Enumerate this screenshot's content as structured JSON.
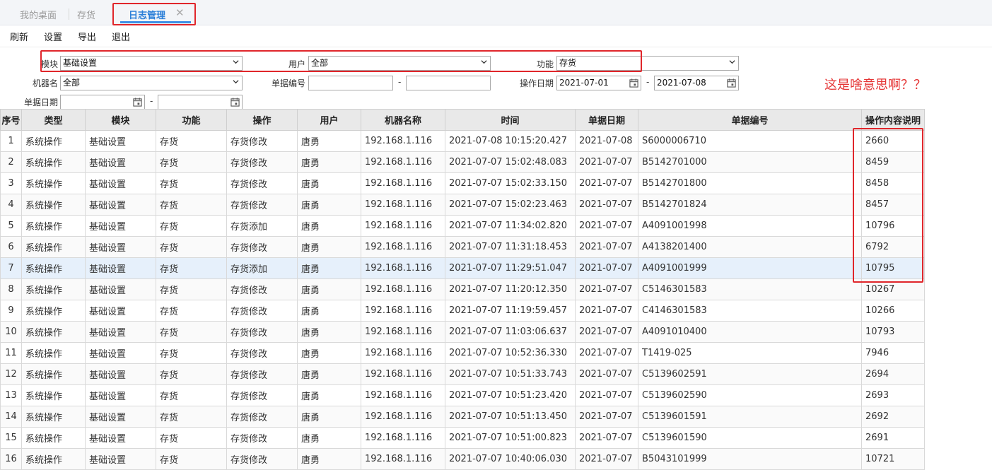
{
  "tabs": [
    {
      "label": "我的桌面",
      "active": false
    },
    {
      "label": "存货",
      "active": false
    },
    {
      "label": "日志管理",
      "active": true
    }
  ],
  "toolbar": {
    "refresh": "刷新",
    "settings": "设置",
    "export": "导出",
    "exit": "退出"
  },
  "filters": {
    "module_label": "模块",
    "module_value": "基础设置",
    "user_label": "用户",
    "user_value": "全部",
    "function_label": "功能",
    "function_value": "存货",
    "machine_label": "机器名",
    "machine_value": "全部",
    "docno_label": "单据编号",
    "docno_from": "",
    "docno_to": "",
    "opdate_label": "操作日期",
    "opdate_from": "2021-07-01",
    "opdate_to": "2021-07-08",
    "docdate_label": "单据日期",
    "docdate_from": "",
    "docdate_to": "",
    "dash": "-"
  },
  "annotation": "这是啥意思啊？？",
  "table": {
    "headers": [
      "序号",
      "类型",
      "模块",
      "功能",
      "操作",
      "用户",
      "机器名称",
      "时间",
      "单据日期",
      "单据编号",
      "操作内容说明"
    ],
    "rows": [
      [
        "1",
        "系统操作",
        "基础设置",
        "存货",
        "存货修改",
        "唐勇",
        "192.168.1.116",
        "2021-07-08 10:15:20.427",
        "2021-07-08",
        "S6000006710",
        "2660"
      ],
      [
        "2",
        "系统操作",
        "基础设置",
        "存货",
        "存货修改",
        "唐勇",
        "192.168.1.116",
        "2021-07-07 15:02:48.083",
        "2021-07-07",
        "B5142701000",
        "8459"
      ],
      [
        "3",
        "系统操作",
        "基础设置",
        "存货",
        "存货修改",
        "唐勇",
        "192.168.1.116",
        "2021-07-07 15:02:33.150",
        "2021-07-07",
        "B5142701800",
        "8458"
      ],
      [
        "4",
        "系统操作",
        "基础设置",
        "存货",
        "存货修改",
        "唐勇",
        "192.168.1.116",
        "2021-07-07 15:02:23.463",
        "2021-07-07",
        "B5142701824",
        "8457"
      ],
      [
        "5",
        "系统操作",
        "基础设置",
        "存货",
        "存货添加",
        "唐勇",
        "192.168.1.116",
        "2021-07-07 11:34:02.820",
        "2021-07-07",
        "A4091001998",
        "10796"
      ],
      [
        "6",
        "系统操作",
        "基础设置",
        "存货",
        "存货修改",
        "唐勇",
        "192.168.1.116",
        "2021-07-07 11:31:18.453",
        "2021-07-07",
        "A4138201400",
        "6792"
      ],
      [
        "7",
        "系统操作",
        "基础设置",
        "存货",
        "存货添加",
        "唐勇",
        "192.168.1.116",
        "2021-07-07 11:29:51.047",
        "2021-07-07",
        "A4091001999",
        "10795"
      ],
      [
        "8",
        "系统操作",
        "基础设置",
        "存货",
        "存货修改",
        "唐勇",
        "192.168.1.116",
        "2021-07-07 11:20:12.350",
        "2021-07-07",
        "C5146301583",
        "10267"
      ],
      [
        "9",
        "系统操作",
        "基础设置",
        "存货",
        "存货修改",
        "唐勇",
        "192.168.1.116",
        "2021-07-07 11:19:59.457",
        "2021-07-07",
        "C4146301583",
        "10266"
      ],
      [
        "10",
        "系统操作",
        "基础设置",
        "存货",
        "存货修改",
        "唐勇",
        "192.168.1.116",
        "2021-07-07 11:03:06.637",
        "2021-07-07",
        "A4091010400",
        "10793"
      ],
      [
        "11",
        "系统操作",
        "基础设置",
        "存货",
        "存货修改",
        "唐勇",
        "192.168.1.116",
        "2021-07-07 10:52:36.330",
        "2021-07-07",
        "T1419-025",
        "7946"
      ],
      [
        "12",
        "系统操作",
        "基础设置",
        "存货",
        "存货修改",
        "唐勇",
        "192.168.1.116",
        "2021-07-07 10:51:33.743",
        "2021-07-07",
        "C5139602591",
        "2694"
      ],
      [
        "13",
        "系统操作",
        "基础设置",
        "存货",
        "存货修改",
        "唐勇",
        "192.168.1.116",
        "2021-07-07 10:51:23.420",
        "2021-07-07",
        "C5139602590",
        "2693"
      ],
      [
        "14",
        "系统操作",
        "基础设置",
        "存货",
        "存货修改",
        "唐勇",
        "192.168.1.116",
        "2021-07-07 10:51:13.450",
        "2021-07-07",
        "C5139601591",
        "2692"
      ],
      [
        "15",
        "系统操作",
        "基础设置",
        "存货",
        "存货修改",
        "唐勇",
        "192.168.1.116",
        "2021-07-07 10:51:00.823",
        "2021-07-07",
        "C5139601590",
        "2691"
      ],
      [
        "16",
        "系统操作",
        "基础设置",
        "存货",
        "存货修改",
        "唐勇",
        "192.168.1.116",
        "2021-07-07 10:40:06.030",
        "2021-07-07",
        "B5043101999",
        "10721"
      ]
    ],
    "selected_row": 7
  },
  "colors": {
    "accent": "#2b7fd8",
    "highlight": "#e0262b",
    "selected_row": "#e6f0fb"
  }
}
